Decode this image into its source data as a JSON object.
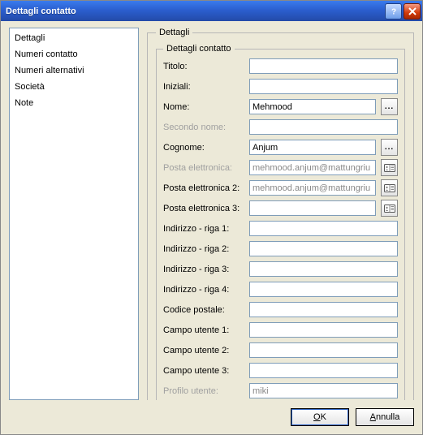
{
  "window": {
    "title": "Dettagli contatto"
  },
  "nav": {
    "items": [
      "Dettagli",
      "Numeri contatto",
      "Numeri alternativi",
      "Società",
      "Note"
    ]
  },
  "groupOuter": {
    "legend": "Dettagli"
  },
  "groupInner": {
    "legend": "Dettagli contatto"
  },
  "fields": {
    "titolo": {
      "label": "Titolo:",
      "value": ""
    },
    "iniziali": {
      "label": "Iniziali:",
      "value": ""
    },
    "nome": {
      "label": "Nome:",
      "value": "Mehmood"
    },
    "secondo": {
      "label": "Secondo nome:",
      "value": ""
    },
    "cognome": {
      "label": "Cognome:",
      "value": "Anjum"
    },
    "email1": {
      "label": "Posta elettronica:",
      "value": "mehmood.anjum@mattungriu"
    },
    "email2": {
      "label": "Posta elettronica 2:",
      "value": "mehmood.anjum@mattungriu"
    },
    "email3": {
      "label": "Posta elettronica 3:",
      "value": ""
    },
    "addr1": {
      "label": "Indirizzo - riga 1:",
      "value": ""
    },
    "addr2": {
      "label": "Indirizzo - riga 2:",
      "value": ""
    },
    "addr3": {
      "label": "Indirizzo - riga 3:",
      "value": ""
    },
    "addr4": {
      "label": "Indirizzo - riga 4:",
      "value": ""
    },
    "cap": {
      "label": "Codice postale:",
      "value": ""
    },
    "cu1": {
      "label": "Campo utente 1:",
      "value": ""
    },
    "cu2": {
      "label": "Campo utente 2:",
      "value": ""
    },
    "cu3": {
      "label": "Campo utente 3:",
      "value": ""
    },
    "profilo": {
      "label": "Profilo utente:",
      "value": "miki"
    }
  },
  "buttons": {
    "ok": {
      "pre": "",
      "mnemonic": "O",
      "post": "K"
    },
    "cancel": {
      "pre": "",
      "mnemonic": "A",
      "post": "nnulla"
    },
    "ellipsis": "..."
  }
}
